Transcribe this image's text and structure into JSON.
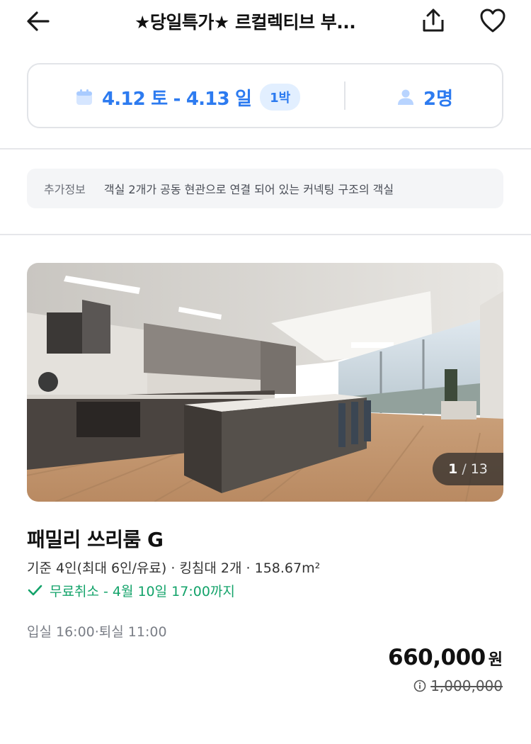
{
  "header": {
    "title": "★당일특가★ 르컬렉티브 부...",
    "back_icon": "arrow-left-icon",
    "share_icon": "share-icon",
    "favorite_icon": "heart-outline-icon"
  },
  "booking": {
    "dates": "4.12 토 - 4.13 일",
    "nights": "1박",
    "guests": "2명",
    "accent_color": "#2d7bf0"
  },
  "extra_info": {
    "label": "추가정보",
    "text": "객실 2개가 공동 현관으로 연결 되어 있는 커넥팅 구조의 객실"
  },
  "photo": {
    "current": "1",
    "separator": "/",
    "total": "13"
  },
  "room": {
    "name": "패밀리 쓰리룸 G",
    "spec": "기준 4인(최대 6인/유료) · 킹침대 2개 · 158.67m²",
    "cancel": "무료취소 - 4월 10일 17:00까지",
    "cancel_color": "#13a36a",
    "checkin": "입실 16:00·퇴실 11:00",
    "price": "660,000",
    "price_unit": "원",
    "original_price": "1,000,000"
  }
}
